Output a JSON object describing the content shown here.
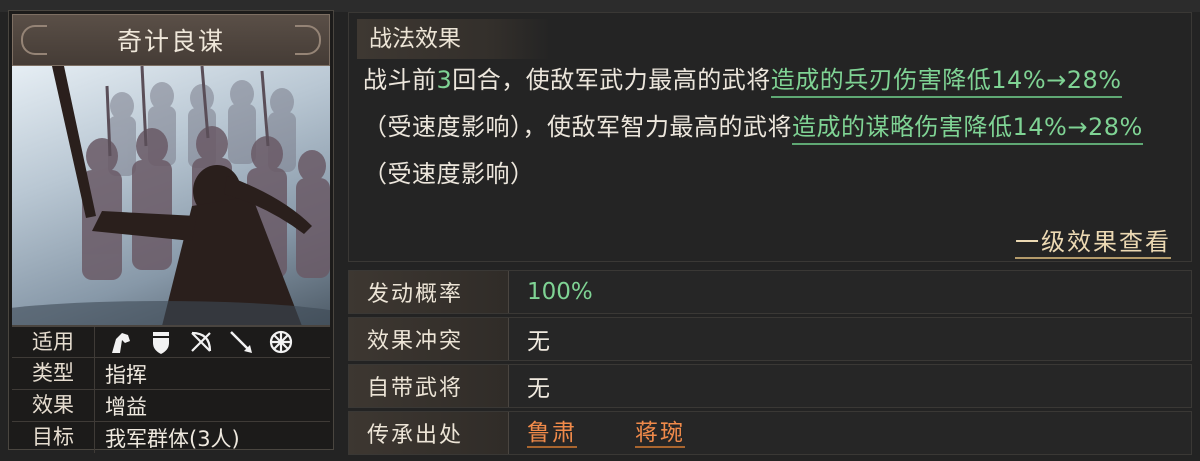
{
  "card": {
    "title": "奇计良谋",
    "rows": [
      {
        "key": "适用",
        "value": ""
      },
      {
        "key": "类型",
        "value": "指挥"
      },
      {
        "key": "效果",
        "value": "增益"
      },
      {
        "key": "目标",
        "value": "我军群体(3人)"
      }
    ],
    "troop_icons": [
      "cavalry-icon",
      "shield-icon",
      "archer-icon",
      "spear-icon",
      "siege-wheel-icon"
    ]
  },
  "effect": {
    "heading": "战法效果",
    "parts": {
      "p1": "战斗前",
      "n1": "3",
      "p2": "回合，使敌军武力最高的武将",
      "u1": "造成的兵刃伤害降低",
      "n2": "14%→28%",
      "p3": "（受速度影响），使敌军智力最高的武将",
      "u2": "造成的谋略伤害降低",
      "n3": "14%→28%",
      "p4": "（受速度影响）"
    },
    "level_link": "一级效果查看"
  },
  "attributes": [
    {
      "key": "发动概率",
      "value": "100%"
    },
    {
      "key": "效果冲突",
      "value": "无"
    },
    {
      "key": "自带武将",
      "value": "无"
    }
  ],
  "inherit": {
    "key": "传承出处",
    "generals": [
      "鲁肃",
      "蒋琬"
    ]
  },
  "colors": {
    "highlight_green": "#7fd394",
    "general_orange": "#f08a4a",
    "link_gold": "#ecd9b3"
  }
}
